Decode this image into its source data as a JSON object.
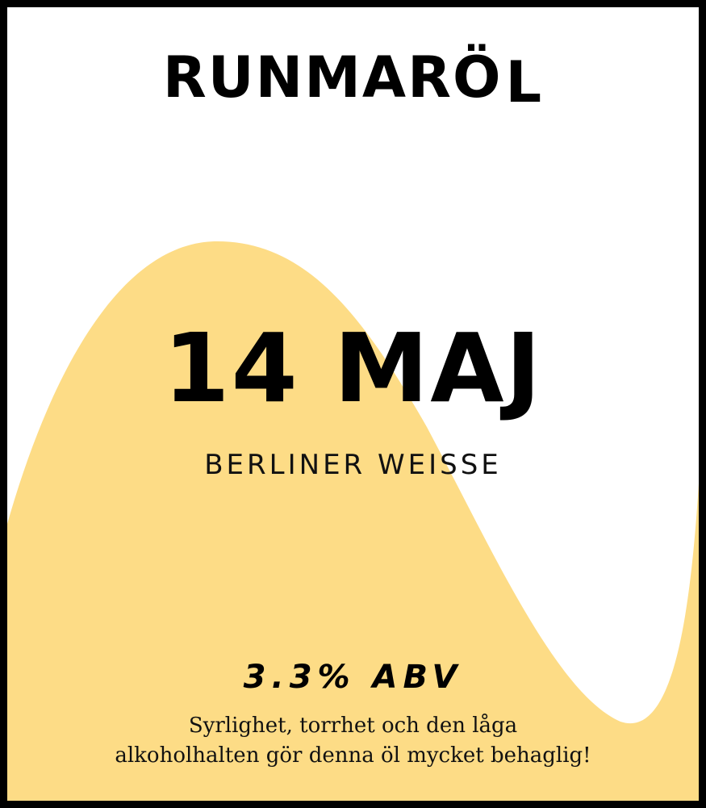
{
  "brand": {
    "name": "RUNMARÖ",
    "mark": "L"
  },
  "beer": {
    "title": "14 MAJ",
    "style": "BERLINER WEISSE",
    "abv": "3.3% ABV",
    "description_line_1": "Syrlighet, torrhet och den låga",
    "description_line_2": "alkoholhalten gör denna öl mycket behaglig!"
  },
  "colors": {
    "border": "#000000",
    "background": "#ffffff",
    "wave": "#fddc86"
  }
}
